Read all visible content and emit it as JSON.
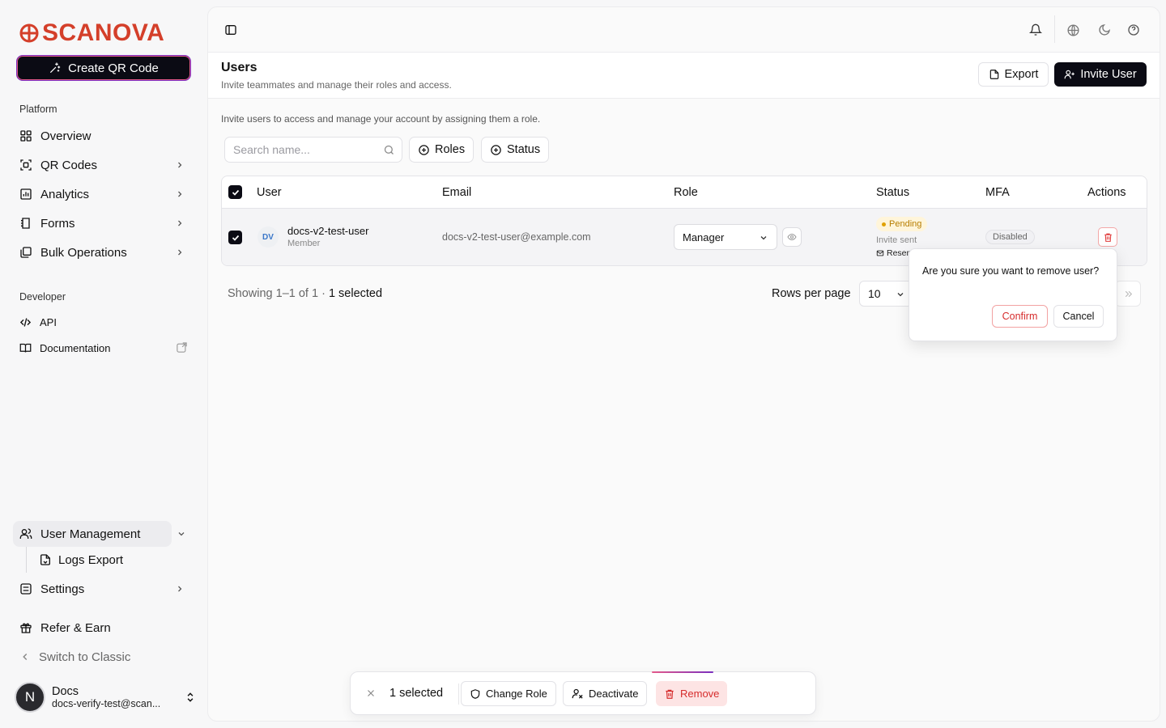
{
  "brand": {
    "name": "SCANOVA",
    "color": "#d43f2a"
  },
  "sidebar": {
    "create_label": "Create QR Code",
    "platform_label": "Platform",
    "platform_items": [
      {
        "label": "Overview",
        "icon": "grid-icon"
      },
      {
        "label": "QR Codes",
        "icon": "qr-scan-icon"
      },
      {
        "label": "Analytics",
        "icon": "chart-icon"
      },
      {
        "label": "Forms",
        "icon": "form-icon"
      },
      {
        "label": "Bulk Operations",
        "icon": "stack-icon"
      }
    ],
    "developer_label": "Developer",
    "developer_items": [
      {
        "label": "API",
        "icon": "code-icon"
      },
      {
        "label": "Documentation",
        "icon": "book-icon"
      }
    ],
    "user_management_label": "User Management",
    "logs_export_label": "Logs Export",
    "settings_label": "Settings",
    "refer_label": "Refer & Earn",
    "classic_label": "Switch to Classic",
    "user": {
      "initial": "N",
      "name": "Docs",
      "email": "docs-verify-test@scan..."
    }
  },
  "header": {
    "title": "Users",
    "subtitle": "Invite teammates and manage their roles and access.",
    "export_label": "Export",
    "invite_label": "Invite User"
  },
  "content": {
    "intro": "Invite users to access and manage your account by assigning them a role.",
    "search_placeholder": "Search name...",
    "filter_roles": "Roles",
    "filter_status": "Status"
  },
  "table": {
    "columns": [
      "User",
      "Email",
      "Role",
      "Status",
      "MFA",
      "Actions"
    ],
    "rows": [
      {
        "initials": "DV",
        "name": "docs-v2-test-user",
        "member": "Member",
        "email": "docs-v2-test-user@example.com",
        "role": "Manager",
        "status": "Pending",
        "invite_note": "Invite sent",
        "resend": "Resen",
        "mfa": "Disabled"
      }
    ]
  },
  "pagination": {
    "showing": "Showing 1–1 of 1 · ",
    "selected": "1 selected",
    "rows_per_page_label": "Rows per page",
    "rows_per_page": "10"
  },
  "popover": {
    "question": "Are you sure you want to remove user?",
    "confirm": "Confirm",
    "cancel": "Cancel"
  },
  "bulk": {
    "count": "1 selected",
    "change_role": "Change Role",
    "deactivate": "Deactivate",
    "remove": "Remove"
  }
}
